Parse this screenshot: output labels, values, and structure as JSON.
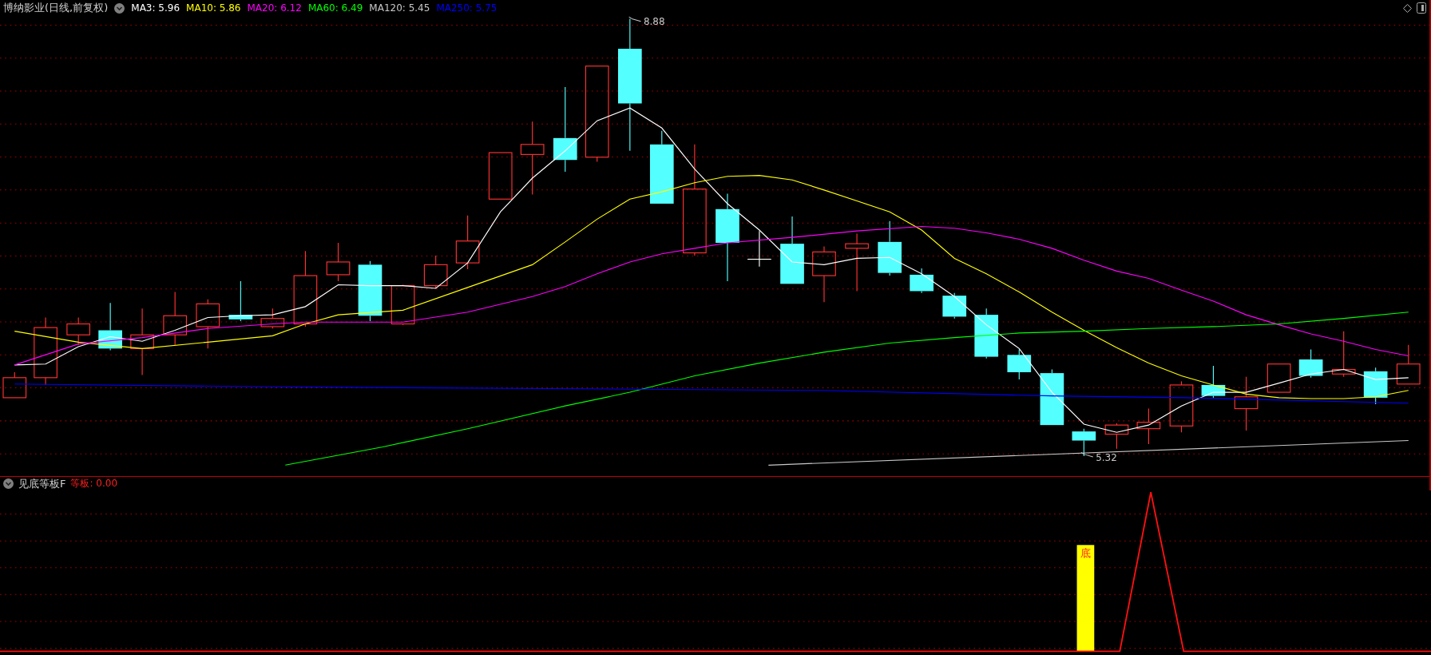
{
  "header": {
    "title": "博纳影业(日线,前复权)",
    "moving_averages": [
      {
        "text": "MA3: 5.96",
        "color": "#ffffff"
      },
      {
        "text": "MA10: 5.86",
        "color": "#ffff00"
      },
      {
        "text": "MA20: 6.12",
        "color": "#ff00ff"
      },
      {
        "text": "MA60: 6.49",
        "color": "#00ff00"
      },
      {
        "text": "MA120: 5.45",
        "color": "#c8c8c8"
      },
      {
        "text": "MA250: 5.75",
        "color": "#0000ff"
      }
    ]
  },
  "price_chart": {
    "high_label": "8.88",
    "low_label": "5.32"
  },
  "indicator": {
    "name": "见底等板F",
    "legend": "等板: 0.00",
    "marker": "底"
  }
}
